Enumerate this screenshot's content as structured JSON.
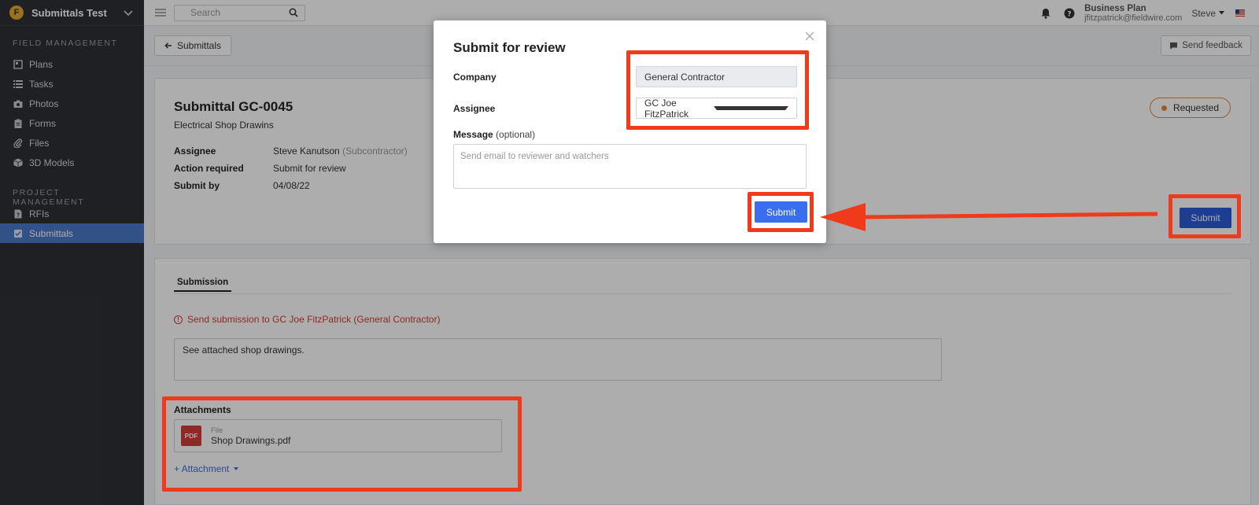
{
  "sidebar": {
    "project_name": "Submittals Test",
    "sections": [
      {
        "title": "FIELD MANAGEMENT",
        "items": [
          {
            "label": "Plans",
            "icon": "plans-icon"
          },
          {
            "label": "Tasks",
            "icon": "tasks-icon"
          },
          {
            "label": "Photos",
            "icon": "camera-icon"
          },
          {
            "label": "Forms",
            "icon": "clipboard-icon"
          },
          {
            "label": "Files",
            "icon": "paperclip-icon"
          },
          {
            "label": "3D Models",
            "icon": "cube-icon"
          }
        ]
      },
      {
        "title": "PROJECT MANAGEMENT",
        "items": [
          {
            "label": "RFIs",
            "icon": "rfi-icon"
          },
          {
            "label": "Submittals",
            "icon": "checkbox-icon",
            "active": true
          }
        ]
      }
    ]
  },
  "topbar": {
    "search_placeholder": "Search",
    "plan_name": "Business Plan",
    "email": "jfitzpatrick@fieldwire.com",
    "user_name": "Steve"
  },
  "page": {
    "back_label": "Submittals",
    "feedback_label": "Send feedback",
    "title": "Submittal GC-0045",
    "subtitle": "Electrical Shop Drawins",
    "status": "Requested",
    "fields": [
      {
        "key": "Assignee",
        "value": "Steve Kanutson",
        "muted": "(Subcontractor)"
      },
      {
        "key": "Action required",
        "value": "Submit for review",
        "muted": ""
      },
      {
        "key": "Submit by",
        "value": "04/08/22",
        "muted": ""
      }
    ],
    "submit_label": "Submit",
    "tab_label": "Submission",
    "warning": "Send submission to GC Joe FitzPatrick (General Contractor)",
    "message": "See attached shop drawings.",
    "attachments_title": "Attachments",
    "attachment": {
      "badge": "PDF",
      "type": "File",
      "name": "Shop Drawings.pdf"
    },
    "add_attachment": "+ Attachment"
  },
  "modal": {
    "title": "Submit for review",
    "company_label": "Company",
    "company_value": "General Contractor",
    "assignee_label": "Assignee",
    "assignee_value": "GC Joe FitzPatrick",
    "message_label": "Message",
    "message_optional": "(optional)",
    "message_placeholder": "Send email to reviewer and watchers",
    "submit_label": "Submit"
  },
  "colors": {
    "annotation_red": "#f03a1c",
    "primary_blue": "#3a6ef0",
    "sidebar_bg": "#2e3036",
    "status_orange": "#e5883a"
  }
}
